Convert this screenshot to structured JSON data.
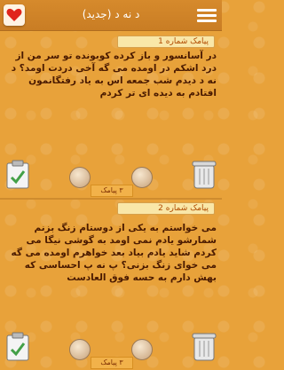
{
  "header": {
    "title": "د نه د (جدید)"
  },
  "messages": [
    {
      "label": "پیامک شماره 1",
      "text": "در آسانسور و باز کرده کوبونده تو سر من از درد اشکم در اومده می گه آخی دردت اومد؟ د نه د دیدم شب جمعه اس به یاد رفتگانمون افتادم به دیده ای تر کردم",
      "count": "۳ پیامک"
    },
    {
      "label": "پیامک شماره 2",
      "text": "می خواستم به یکی از دوستام زنگ بزنم شمارشو یادم نمی اومد به گوشی نیگا می کردم شاید یادم بیاد بعد خواهرم اومده می گه می خوای زنگ بزنی؟ پ نه پ احساسی که بهش دارم به حسه فوق العادست",
      "count": "۳ پیامک"
    }
  ]
}
